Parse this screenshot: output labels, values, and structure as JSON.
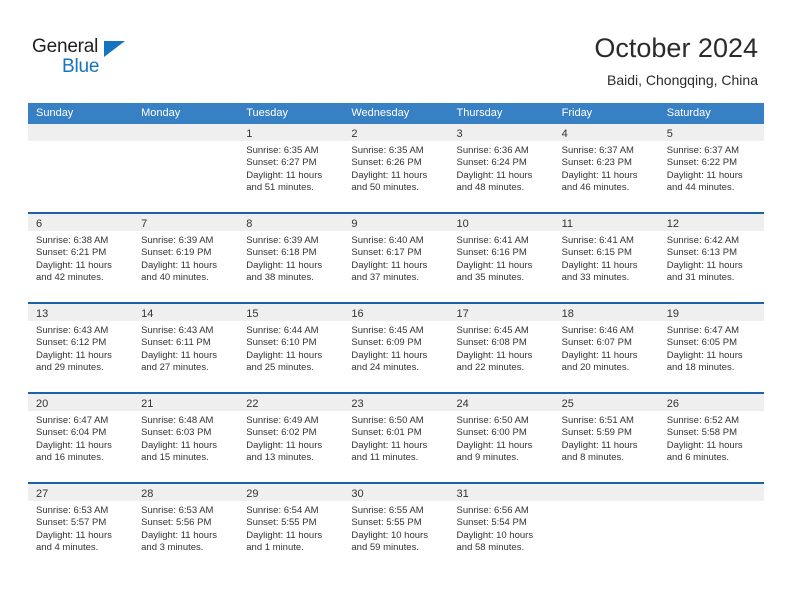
{
  "brand": {
    "name_top": "General",
    "name_bottom": "Blue",
    "accent_color": "#1673bf"
  },
  "header": {
    "title": "October 2024",
    "subtitle": "Baidi, Chongqing, China"
  },
  "theme": {
    "header_row_bg": "#3880c4",
    "week_divider": "#1c62a6",
    "daynum_band_bg": "#efefef",
    "text_color": "#333333"
  },
  "labels": {
    "sunrise_prefix": "Sunrise:",
    "sunset_prefix": "Sunset:",
    "daylight_prefix": "Daylight:"
  },
  "day_names": [
    "Sunday",
    "Monday",
    "Tuesday",
    "Wednesday",
    "Thursday",
    "Friday",
    "Saturday"
  ],
  "weeks": [
    [
      {
        "empty": true
      },
      {
        "empty": true
      },
      {
        "day": "1",
        "sunrise": "Sunrise: 6:35 AM",
        "sunset": "Sunset: 6:27 PM",
        "daylight_a": "Daylight: 11 hours",
        "daylight_b": "and 51 minutes."
      },
      {
        "day": "2",
        "sunrise": "Sunrise: 6:35 AM",
        "sunset": "Sunset: 6:26 PM",
        "daylight_a": "Daylight: 11 hours",
        "daylight_b": "and 50 minutes."
      },
      {
        "day": "3",
        "sunrise": "Sunrise: 6:36 AM",
        "sunset": "Sunset: 6:24 PM",
        "daylight_a": "Daylight: 11 hours",
        "daylight_b": "and 48 minutes."
      },
      {
        "day": "4",
        "sunrise": "Sunrise: 6:37 AM",
        "sunset": "Sunset: 6:23 PM",
        "daylight_a": "Daylight: 11 hours",
        "daylight_b": "and 46 minutes."
      },
      {
        "day": "5",
        "sunrise": "Sunrise: 6:37 AM",
        "sunset": "Sunset: 6:22 PM",
        "daylight_a": "Daylight: 11 hours",
        "daylight_b": "and 44 minutes."
      }
    ],
    [
      {
        "day": "6",
        "sunrise": "Sunrise: 6:38 AM",
        "sunset": "Sunset: 6:21 PM",
        "daylight_a": "Daylight: 11 hours",
        "daylight_b": "and 42 minutes."
      },
      {
        "day": "7",
        "sunrise": "Sunrise: 6:39 AM",
        "sunset": "Sunset: 6:19 PM",
        "daylight_a": "Daylight: 11 hours",
        "daylight_b": "and 40 minutes."
      },
      {
        "day": "8",
        "sunrise": "Sunrise: 6:39 AM",
        "sunset": "Sunset: 6:18 PM",
        "daylight_a": "Daylight: 11 hours",
        "daylight_b": "and 38 minutes."
      },
      {
        "day": "9",
        "sunrise": "Sunrise: 6:40 AM",
        "sunset": "Sunset: 6:17 PM",
        "daylight_a": "Daylight: 11 hours",
        "daylight_b": "and 37 minutes."
      },
      {
        "day": "10",
        "sunrise": "Sunrise: 6:41 AM",
        "sunset": "Sunset: 6:16 PM",
        "daylight_a": "Daylight: 11 hours",
        "daylight_b": "and 35 minutes."
      },
      {
        "day": "11",
        "sunrise": "Sunrise: 6:41 AM",
        "sunset": "Sunset: 6:15 PM",
        "daylight_a": "Daylight: 11 hours",
        "daylight_b": "and 33 minutes."
      },
      {
        "day": "12",
        "sunrise": "Sunrise: 6:42 AM",
        "sunset": "Sunset: 6:13 PM",
        "daylight_a": "Daylight: 11 hours",
        "daylight_b": "and 31 minutes."
      }
    ],
    [
      {
        "day": "13",
        "sunrise": "Sunrise: 6:43 AM",
        "sunset": "Sunset: 6:12 PM",
        "daylight_a": "Daylight: 11 hours",
        "daylight_b": "and 29 minutes."
      },
      {
        "day": "14",
        "sunrise": "Sunrise: 6:43 AM",
        "sunset": "Sunset: 6:11 PM",
        "daylight_a": "Daylight: 11 hours",
        "daylight_b": "and 27 minutes."
      },
      {
        "day": "15",
        "sunrise": "Sunrise: 6:44 AM",
        "sunset": "Sunset: 6:10 PM",
        "daylight_a": "Daylight: 11 hours",
        "daylight_b": "and 25 minutes."
      },
      {
        "day": "16",
        "sunrise": "Sunrise: 6:45 AM",
        "sunset": "Sunset: 6:09 PM",
        "daylight_a": "Daylight: 11 hours",
        "daylight_b": "and 24 minutes."
      },
      {
        "day": "17",
        "sunrise": "Sunrise: 6:45 AM",
        "sunset": "Sunset: 6:08 PM",
        "daylight_a": "Daylight: 11 hours",
        "daylight_b": "and 22 minutes."
      },
      {
        "day": "18",
        "sunrise": "Sunrise: 6:46 AM",
        "sunset": "Sunset: 6:07 PM",
        "daylight_a": "Daylight: 11 hours",
        "daylight_b": "and 20 minutes."
      },
      {
        "day": "19",
        "sunrise": "Sunrise: 6:47 AM",
        "sunset": "Sunset: 6:05 PM",
        "daylight_a": "Daylight: 11 hours",
        "daylight_b": "and 18 minutes."
      }
    ],
    [
      {
        "day": "20",
        "sunrise": "Sunrise: 6:47 AM",
        "sunset": "Sunset: 6:04 PM",
        "daylight_a": "Daylight: 11 hours",
        "daylight_b": "and 16 minutes."
      },
      {
        "day": "21",
        "sunrise": "Sunrise: 6:48 AM",
        "sunset": "Sunset: 6:03 PM",
        "daylight_a": "Daylight: 11 hours",
        "daylight_b": "and 15 minutes."
      },
      {
        "day": "22",
        "sunrise": "Sunrise: 6:49 AM",
        "sunset": "Sunset: 6:02 PM",
        "daylight_a": "Daylight: 11 hours",
        "daylight_b": "and 13 minutes."
      },
      {
        "day": "23",
        "sunrise": "Sunrise: 6:50 AM",
        "sunset": "Sunset: 6:01 PM",
        "daylight_a": "Daylight: 11 hours",
        "daylight_b": "and 11 minutes."
      },
      {
        "day": "24",
        "sunrise": "Sunrise: 6:50 AM",
        "sunset": "Sunset: 6:00 PM",
        "daylight_a": "Daylight: 11 hours",
        "daylight_b": "and 9 minutes."
      },
      {
        "day": "25",
        "sunrise": "Sunrise: 6:51 AM",
        "sunset": "Sunset: 5:59 PM",
        "daylight_a": "Daylight: 11 hours",
        "daylight_b": "and 8 minutes."
      },
      {
        "day": "26",
        "sunrise": "Sunrise: 6:52 AM",
        "sunset": "Sunset: 5:58 PM",
        "daylight_a": "Daylight: 11 hours",
        "daylight_b": "and 6 minutes."
      }
    ],
    [
      {
        "day": "27",
        "sunrise": "Sunrise: 6:53 AM",
        "sunset": "Sunset: 5:57 PM",
        "daylight_a": "Daylight: 11 hours",
        "daylight_b": "and 4 minutes."
      },
      {
        "day": "28",
        "sunrise": "Sunrise: 6:53 AM",
        "sunset": "Sunset: 5:56 PM",
        "daylight_a": "Daylight: 11 hours",
        "daylight_b": "and 3 minutes."
      },
      {
        "day": "29",
        "sunrise": "Sunrise: 6:54 AM",
        "sunset": "Sunset: 5:55 PM",
        "daylight_a": "Daylight: 11 hours",
        "daylight_b": "and 1 minute."
      },
      {
        "day": "30",
        "sunrise": "Sunrise: 6:55 AM",
        "sunset": "Sunset: 5:55 PM",
        "daylight_a": "Daylight: 10 hours",
        "daylight_b": "and 59 minutes."
      },
      {
        "day": "31",
        "sunrise": "Sunrise: 6:56 AM",
        "sunset": "Sunset: 5:54 PM",
        "daylight_a": "Daylight: 10 hours",
        "daylight_b": "and 58 minutes."
      },
      {
        "empty": true
      },
      {
        "empty": true
      }
    ]
  ]
}
